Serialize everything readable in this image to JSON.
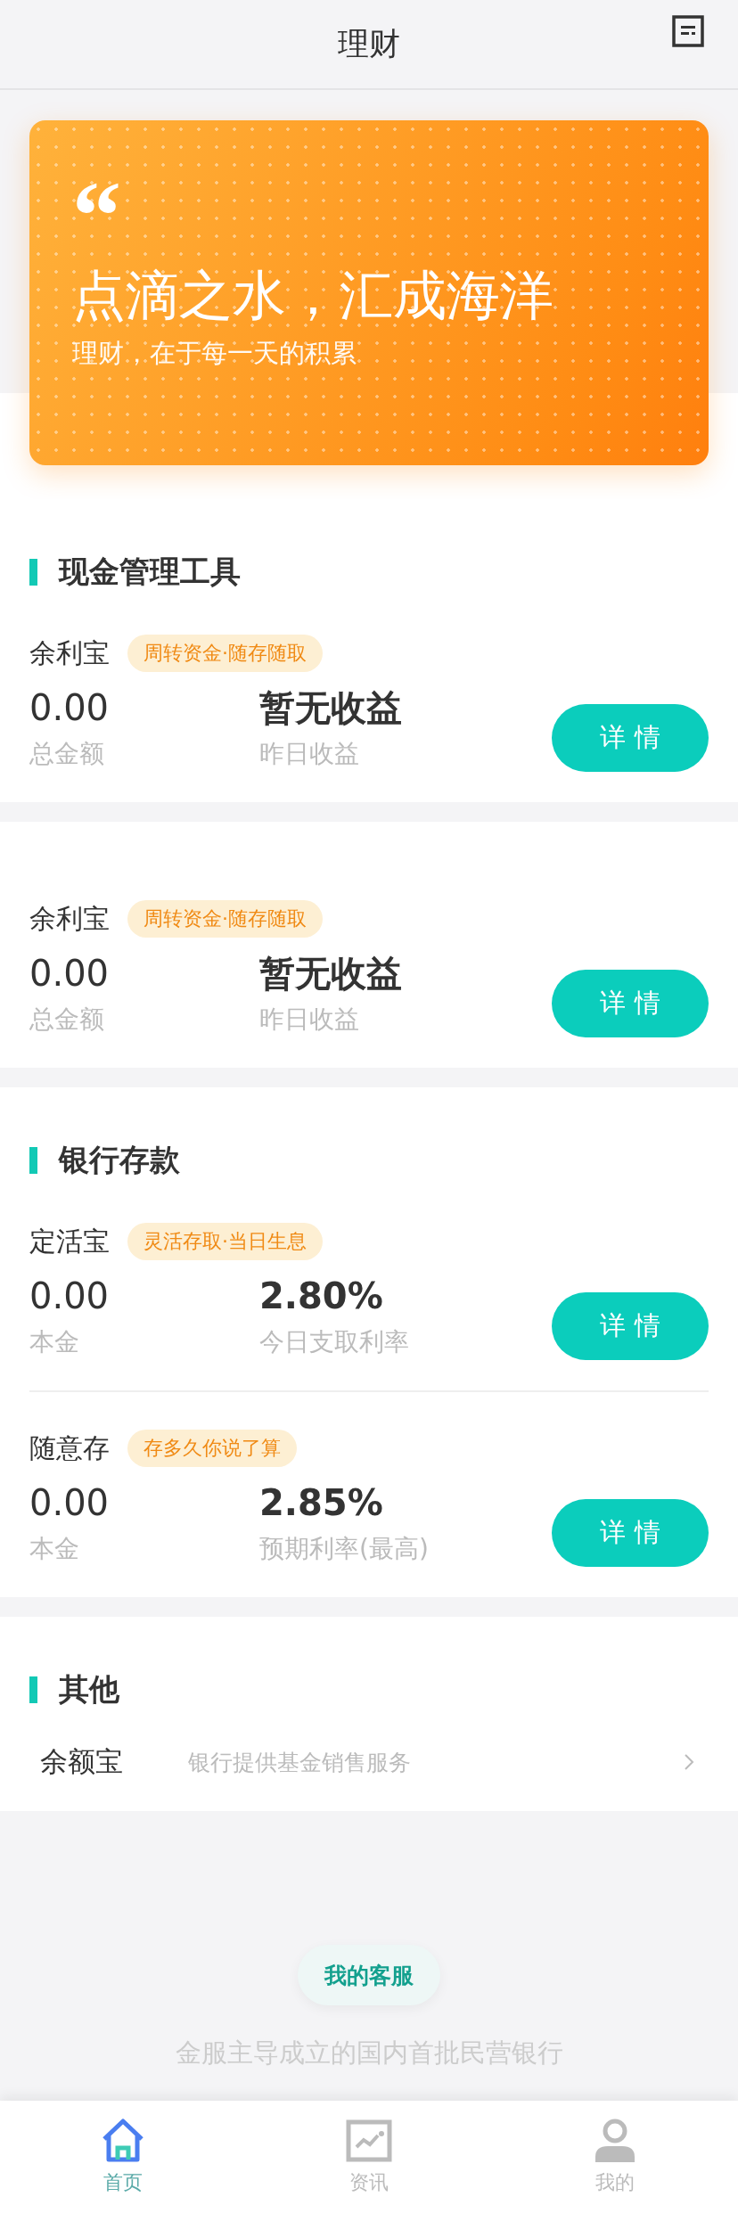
{
  "header": {
    "title": "理财"
  },
  "banner": {
    "quote": "“",
    "headline": "点滴之水，汇成海洋",
    "subtitle": "理财，在于每一天的积累"
  },
  "groups": [
    {
      "title": "现金管理工具",
      "products": [
        {
          "name": "余利宝",
          "tag": "周转资金·随存随取",
          "value": "0.00",
          "value_label": "总金额",
          "yield": "暂无收益",
          "yield_label": "昨日收益",
          "button": "详 情"
        }
      ]
    },
    {
      "products": [
        {
          "name": "余利宝",
          "tag": "周转资金·随存随取",
          "value": "0.00",
          "value_label": "总金额",
          "yield": "暂无收益",
          "yield_label": "昨日收益",
          "button": "详 情"
        }
      ]
    },
    {
      "title": "银行存款",
      "products": [
        {
          "name": "定活宝",
          "tag": "灵活存取·当日生息",
          "value": "0.00",
          "value_label": "本金",
          "yield": "2.80%",
          "yield_label": "今日支取利率",
          "button": "详 情"
        },
        {
          "name": "随意存",
          "tag": "存多久你说了算",
          "value": "0.00",
          "value_label": "本金",
          "yield": "2.85%",
          "yield_label": "预期利率(最高)",
          "button": "详 情"
        }
      ]
    }
  ],
  "other": {
    "title": "其他",
    "rows": [
      {
        "name": "余额宝",
        "description": "银行提供基金销售服务"
      }
    ]
  },
  "service": {
    "button": "我的客服",
    "tagline": "金服主导成立的国内首批民营银行"
  },
  "tabs": [
    {
      "kind": "home",
      "label": "首页",
      "selected": true
    },
    {
      "kind": "news",
      "label": "资讯",
      "selected": false
    },
    {
      "kind": "profile",
      "label": "我的",
      "selected": false
    }
  ]
}
